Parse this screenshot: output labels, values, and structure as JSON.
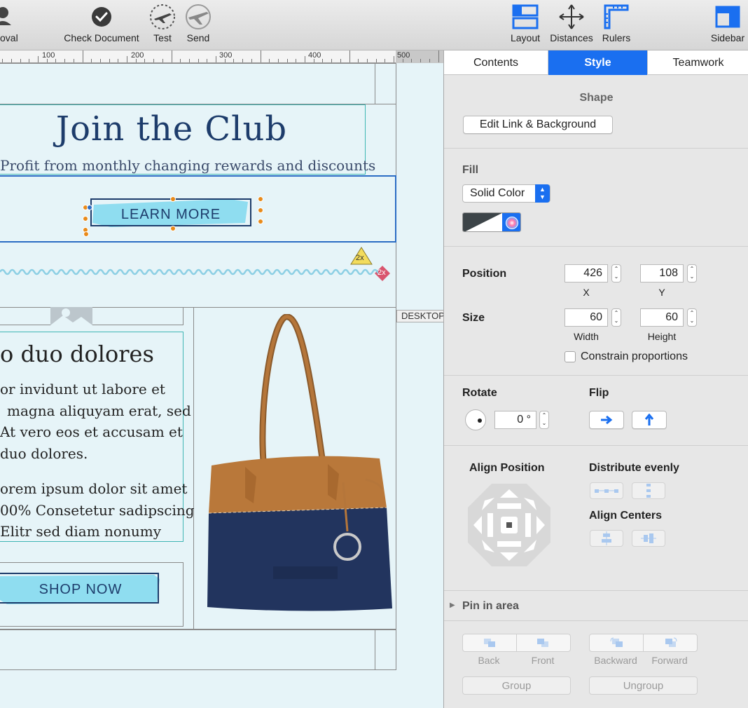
{
  "toolbar": {
    "approval_label": "oval",
    "check_document_label": "Check Document",
    "test_label": "Test",
    "send_label": "Send",
    "layout_label": "Layout",
    "distances_label": "Distances",
    "rulers_label": "Rulers",
    "sidebar_label": "Sidebar"
  },
  "ruler": {
    "marks": [
      "100",
      "200",
      "300",
      "400",
      "500"
    ]
  },
  "canvas": {
    "headline": "Join the Club",
    "subheadline": "Profit from monthly changing rewards and discounts",
    "learn_more": "LEARN MORE",
    "badge_warning": "2x",
    "badge_error": "2x",
    "desktop_label": "DESKTOP",
    "article_title": "o duo dolores",
    "para1_lines": [
      "or invidunt ut labore et",
      "magna aliquyam erat, sed",
      "At vero eos et accusam et",
      "duo dolores."
    ],
    "para2_lines": [
      "orem ipsum dolor sit amet",
      "00% Consetetur sadipscing",
      "Elitr sed diam nonumy"
    ],
    "shop_now": "SHOP NOW"
  },
  "sidebar": {
    "tabs": [
      "Contents",
      "Style",
      "Teamwork"
    ],
    "active_tab": "Style",
    "shape_title": "Shape",
    "edit_link_button": "Edit Link & Background",
    "fill_title": "Fill",
    "fill_type": "Solid Color",
    "fill_color": "#3c4448",
    "position_title": "Position",
    "position_x": "426",
    "position_y": "108",
    "x_caption": "X",
    "y_caption": "Y",
    "size_title": "Size",
    "size_width": "60",
    "size_height": "60",
    "width_caption": "Width",
    "height_caption": "Height",
    "constrain_label": "Constrain proportions",
    "constrain_checked": false,
    "rotate_title": "Rotate",
    "rotate_value": "0 °",
    "flip_title": "Flip",
    "align_position_title": "Align Position",
    "distribute_title": "Distribute evenly",
    "align_centers_title": "Align Centers",
    "pin_title": "Pin in area",
    "back_label": "Back",
    "front_label": "Front",
    "backward_label": "Backward",
    "forward_label": "Forward",
    "group_label": "Group",
    "ungroup_label": "Ungroup"
  },
  "colors": {
    "accent": "#1a6ff0",
    "headline": "#1d3c6b",
    "button_cyan": "#7fd8ee",
    "selection_blue": "#2b6cc4",
    "handle_orange": "#e88a1a"
  }
}
